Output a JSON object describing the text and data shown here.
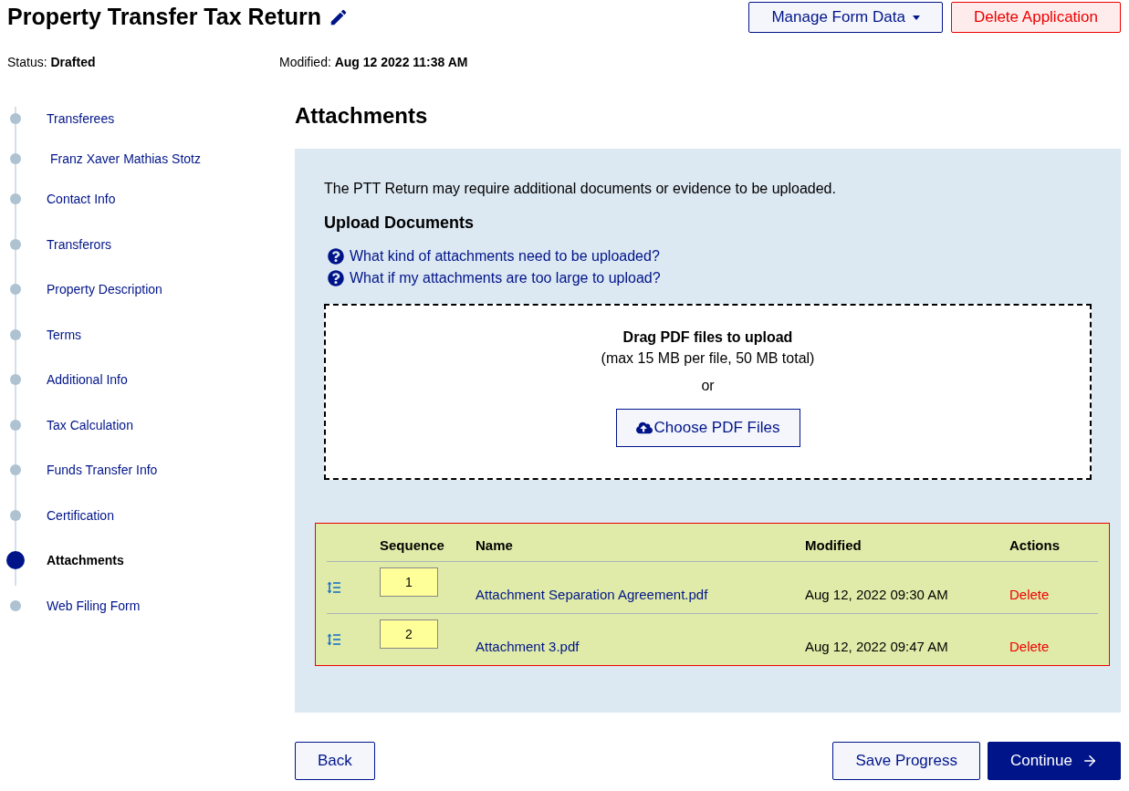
{
  "header": {
    "title": "Property Transfer Tax Return",
    "buttons": [
      {
        "label": "Manage Form Data",
        "kind": "dropdown"
      },
      {
        "label": "Delete Application",
        "kind": "danger"
      }
    ]
  },
  "meta": [
    {
      "label": "Status:",
      "value": "Drafted"
    },
    {
      "label": "Modified:",
      "value": "Aug 12 2022 11:38 AM"
    }
  ],
  "steps": [
    {
      "label": "Transferees",
      "selected": false,
      "children": [
        {
          "label": "Franz Xaver Mathias Stotz",
          "selected": false
        }
      ]
    },
    {
      "label": "Contact Info",
      "selected": false
    },
    {
      "label": "Transferors",
      "selected": false
    },
    {
      "label": "Property Description",
      "selected": false
    },
    {
      "label": "Terms",
      "selected": false
    },
    {
      "label": "Additional Info",
      "selected": false
    },
    {
      "label": "Tax Calculation",
      "selected": false
    },
    {
      "label": "Funds Transfer Info",
      "selected": false
    },
    {
      "label": "Certification",
      "selected": false
    },
    {
      "label": "Attachments",
      "selected": true
    },
    {
      "label": "Web Filing Form",
      "selected": false
    }
  ],
  "section": {
    "title": "Attachments",
    "intro": "The PTT Return may require additional documents or evidence to be uploaded.",
    "subtitle": "Upload Documents",
    "help_links": [
      "What kind of attachments need to be uploaded?",
      "What if my attachments are too large to upload?"
    ],
    "dropzone": {
      "title": "Drag PDF files to upload",
      "limits": "(max 15 MB per file, 50 MB total)",
      "separator": "or",
      "button": "Choose PDF Files"
    },
    "table": {
      "columns": [
        "Sequence",
        "Name",
        "Modified",
        "Actions"
      ],
      "rows": [
        {
          "sequence": "1",
          "name": "Attachment Separation Agreement.pdf",
          "modified": "Aug 12, 2022 09:30 AM",
          "action": "Delete"
        },
        {
          "sequence": "2",
          "name": "Attachment 3.pdf",
          "modified": "Aug 12, 2022 09:47 AM",
          "action": "Delete"
        }
      ]
    }
  },
  "footer": [
    {
      "label": "Back",
      "kind": "secondary"
    },
    {
      "label": "Save Progress",
      "kind": "secondary"
    },
    {
      "label": "Continue",
      "kind": "primary"
    }
  ]
}
